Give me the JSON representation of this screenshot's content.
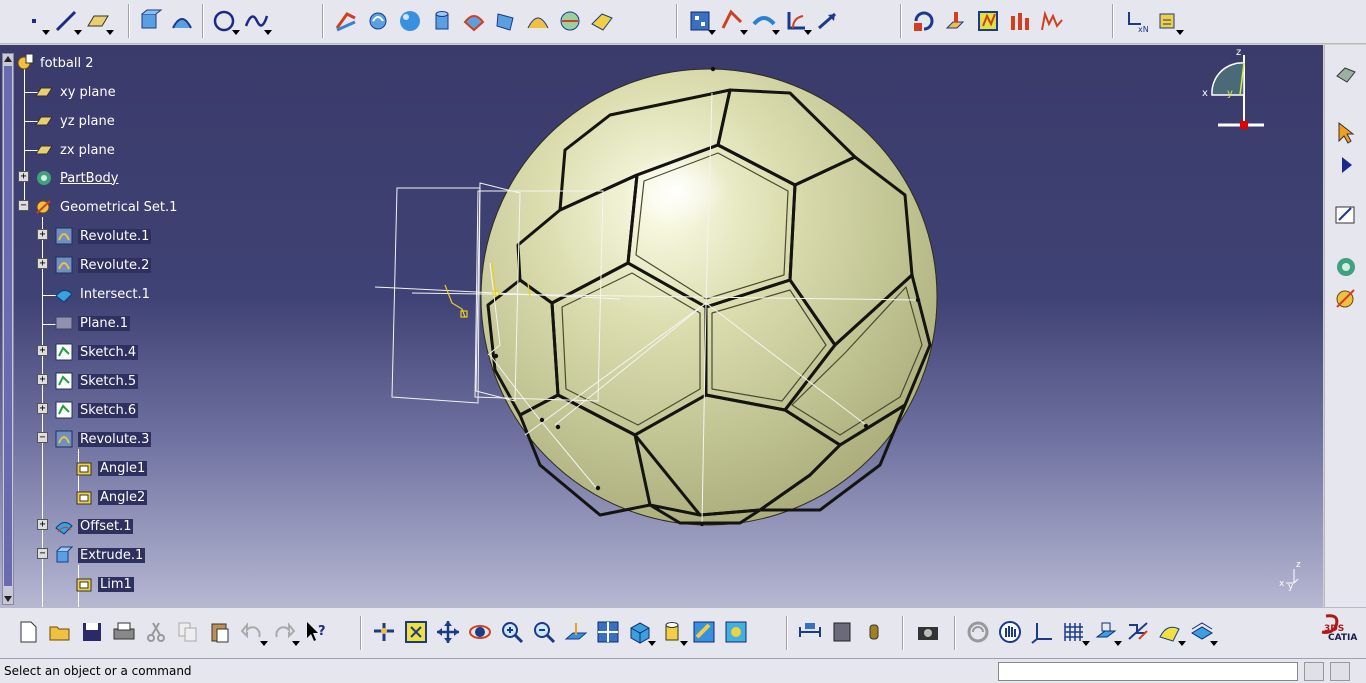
{
  "document": {
    "title": "fotball 2"
  },
  "tree": {
    "root": "fotball 2",
    "items": [
      {
        "label": "xy plane",
        "icon": "plane-icon"
      },
      {
        "label": "yz plane",
        "icon": "plane-icon"
      },
      {
        "label": "zx plane",
        "icon": "plane-icon"
      },
      {
        "label": "PartBody",
        "icon": "partbody-icon"
      },
      {
        "label": "Geometrical Set.1",
        "icon": "geometrical-set-icon"
      },
      {
        "label": "Revolute.1",
        "icon": "revolute-icon"
      },
      {
        "label": "Revolute.2",
        "icon": "revolute-icon"
      },
      {
        "label": "Intersect.1",
        "icon": "intersect-icon"
      },
      {
        "label": "Plane.1",
        "icon": "plane-feature-icon"
      },
      {
        "label": "Sketch.4",
        "icon": "sketch-icon"
      },
      {
        "label": "Sketch.5",
        "icon": "sketch-icon"
      },
      {
        "label": "Sketch.6",
        "icon": "sketch-icon"
      },
      {
        "label": "Revolute.3",
        "icon": "revolute-icon"
      },
      {
        "label": "Angle1",
        "icon": "angle-icon"
      },
      {
        "label": "Angle2",
        "icon": "angle-icon"
      },
      {
        "label": "Offset.1",
        "icon": "offset-icon"
      },
      {
        "label": "Extrude.1",
        "icon": "extrude-icon"
      },
      {
        "label": "Lim1",
        "icon": "limit-icon"
      }
    ]
  },
  "compass": {
    "x_label": "x",
    "y_label": "y",
    "z_label": "z"
  },
  "axis_indicator": {
    "x_label": "x",
    "y_label": "y",
    "z_label": "z"
  },
  "status": {
    "message": "Select an object or a command",
    "input_value": ""
  },
  "brand": {
    "logo": "CATIA",
    "mark": "3DS"
  },
  "colors": {
    "background_top": "#3a3b6b",
    "background_bottom": "#b6b7d2",
    "ball_fill": "#d6d8a8",
    "selection": "#2e3060"
  },
  "toolbars": {
    "top": [
      "point-icon",
      "line-icon",
      "plane-icon",
      "extrude-icon",
      "revolve-icon",
      "circle-icon",
      "spline-icon",
      "offset-icon",
      "sweep-icon",
      "sphere-icon",
      "cylinder-icon",
      "fill-icon",
      "multi-section-icon",
      "blend-icon",
      "join-icon",
      "split-icon",
      "trim-icon",
      "boundary-icon",
      "extract-icon",
      "fillet-icon",
      "translate-icon",
      "rotate-icon",
      "symmetry-icon",
      "scale-icon",
      "affinity-icon",
      "repetition-icon",
      "knowledge-icon"
    ],
    "bottom": [
      "new-icon",
      "open-icon",
      "save-icon",
      "print-icon",
      "cut-icon",
      "copy-icon",
      "paste-icon",
      "undo-icon",
      "redo-icon",
      "whats-this-icon",
      "fly-icon",
      "fit-all-icon",
      "pan-icon",
      "rotate-view-icon",
      "zoom-in-icon",
      "zoom-out-icon",
      "normal-view-icon",
      "multi-view-icon",
      "iso-view-icon",
      "shading-icon",
      "hide-show-icon",
      "swap-visible-icon",
      "measure-icon",
      "apply-material-icon",
      "capture-icon",
      "update-icon",
      "grab-icon",
      "axis-icon",
      "grid-icon",
      "work-on-support-icon",
      "snap-icon",
      "render-style-icon",
      "layer-icon"
    ]
  }
}
